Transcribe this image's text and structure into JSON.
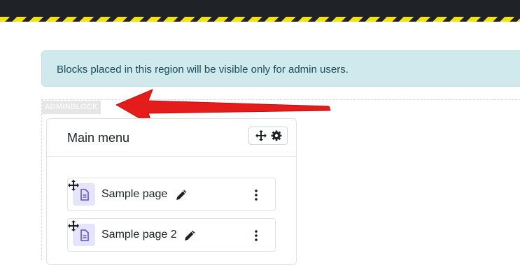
{
  "alert": {
    "message": "Blocks placed in this region will be visible only for admin users."
  },
  "region": {
    "label": "ADMINBLOCK"
  },
  "block": {
    "title": "Main menu",
    "items": [
      {
        "label": "Sample page"
      },
      {
        "label": "Sample page 2"
      }
    ]
  },
  "icons": {
    "move": "move-icon",
    "settings": "gear-icon",
    "item_page": "page-icon",
    "item_drag": "drag-move-icon",
    "edit": "pencil-icon",
    "more": "kebab-menu-icon",
    "annotation": "red-arrow-annotation"
  },
  "colors": {
    "alert_bg": "#cfe9ed",
    "alert_text": "#194d56",
    "hazard_yellow": "#f3e30a",
    "topbar": "#1f2327",
    "annotation_red": "#e41c1c",
    "page_icon_bg": "#e6e4fb",
    "page_icon": "#5b4fd6"
  }
}
